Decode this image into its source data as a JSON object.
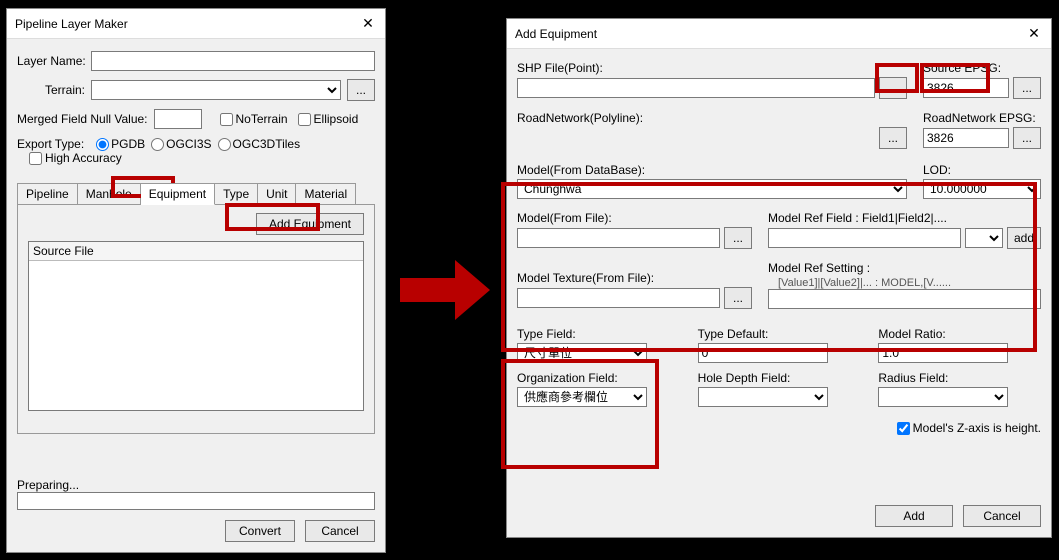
{
  "left": {
    "title": "Pipeline Layer Maker",
    "layerName_lbl": "Layer Name:",
    "layerName_val": "",
    "terrain_lbl": "Terrain:",
    "terrain_val": "",
    "terrain_browse": "...",
    "mergedNull_lbl": "Merged Field Null Value:",
    "mergedNull_val": "",
    "noTerrain_lbl": "NoTerrain",
    "ellipsoid_lbl": "Ellipsoid",
    "exportType_lbl": "Export Type:",
    "opt_pgdb": "PGDB",
    "opt_ogci3s": "OGCI3S",
    "opt_ogc3dtiles": "OGC3DTiles",
    "highAccuracy_lbl": "High Accuracy",
    "tabs": [
      "Pipeline",
      "Manhole",
      "Equipment",
      "Type",
      "Unit",
      "Material"
    ],
    "active_tab": "Equipment",
    "add_equipment_btn": "Add Equipment",
    "list_header": "Source File",
    "preparing_lbl": "Preparing...",
    "convert_btn": "Convert",
    "cancel_btn": "Cancel"
  },
  "right": {
    "title": "Add Equipment",
    "shp_lbl": "SHP File(Point):",
    "shp_val": "",
    "shp_browse": "...",
    "srcEpsg_lbl": "Source EPSG:",
    "srcEpsg_val": "3826",
    "srcEpsg_browse": "...",
    "road_lbl": "RoadNetwork(Polyline):",
    "road_val": "",
    "road_browse": "...",
    "roadEpsg_lbl": "RoadNetwork EPSG:",
    "roadEpsg_val": "3826",
    "roadEpsg_browse": "...",
    "modelDb_lbl": "Model(From DataBase):",
    "modelDb_val": "Chunghwa",
    "lod_lbl": "LOD:",
    "lod_val": "10.000000",
    "modelFile_lbl": "Model(From File):",
    "modelFile_val": "",
    "modelFile_browse": "...",
    "modelRefField_lbl": "Model Ref Field : Field1|Field2|....",
    "modelRefField_val": "",
    "modelRefField_add": "add",
    "modelTex_lbl": "Model Texture(From File):",
    "modelTex_val": "",
    "modelTex_browse": "...",
    "modelRefSetting_lbl": "Model Ref Setting :",
    "modelRefSetting_hint": "[Value1]|[Value2]|... : MODEL,[V......",
    "modelRefSetting_val": "",
    "typeField_lbl": "Type Field:",
    "typeField_val": "尺寸單位",
    "typeDefault_lbl": "Type Default:",
    "typeDefault_val": "0",
    "modelRatio_lbl": "Model Ratio:",
    "modelRatio_val": "1.0",
    "orgField_lbl": "Organization Field:",
    "orgField_val": "供應商參考欄位",
    "holeDepth_lbl": "Hole Depth Field:",
    "holeDepth_val": "",
    "radius_lbl": "Radius Field:",
    "radius_val": "",
    "zHeight_lbl": "Model's Z-axis is height.",
    "add_btn": "Add",
    "cancel_btn": "Cancel"
  }
}
